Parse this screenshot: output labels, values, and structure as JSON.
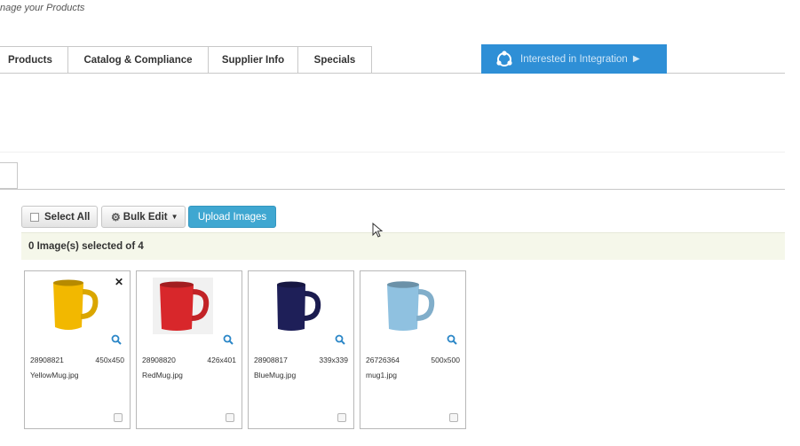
{
  "header": {
    "subtitle": "nage your Products"
  },
  "tabs": [
    {
      "label": "Products"
    },
    {
      "label": "Catalog & Compliance"
    },
    {
      "label": "Supplier Info"
    },
    {
      "label": "Specials"
    }
  ],
  "integration": {
    "label": "Interested in Integration",
    "color": "#2e8fd6"
  },
  "toolbar": {
    "select_all_label": "Select All",
    "bulk_edit_label": "Bulk Edit",
    "upload_label": "Upload Images"
  },
  "selection": {
    "status_text": "0 Image(s) selected of 4"
  },
  "images": [
    {
      "id": "28908821",
      "dimensions": "450x450",
      "filename": "YellowMug.jpg",
      "color": "#f2b800"
    },
    {
      "id": "28908820",
      "dimensions": "426x401",
      "filename": "RedMug.jpg",
      "color": "#d8272b"
    },
    {
      "id": "28908817",
      "dimensions": "339x339",
      "filename": "BlueMug.jpg",
      "color": "#1e1f58"
    },
    {
      "id": "26726364",
      "dimensions": "500x500",
      "filename": "mug1.jpg",
      "color": "#8fc1e0"
    }
  ]
}
